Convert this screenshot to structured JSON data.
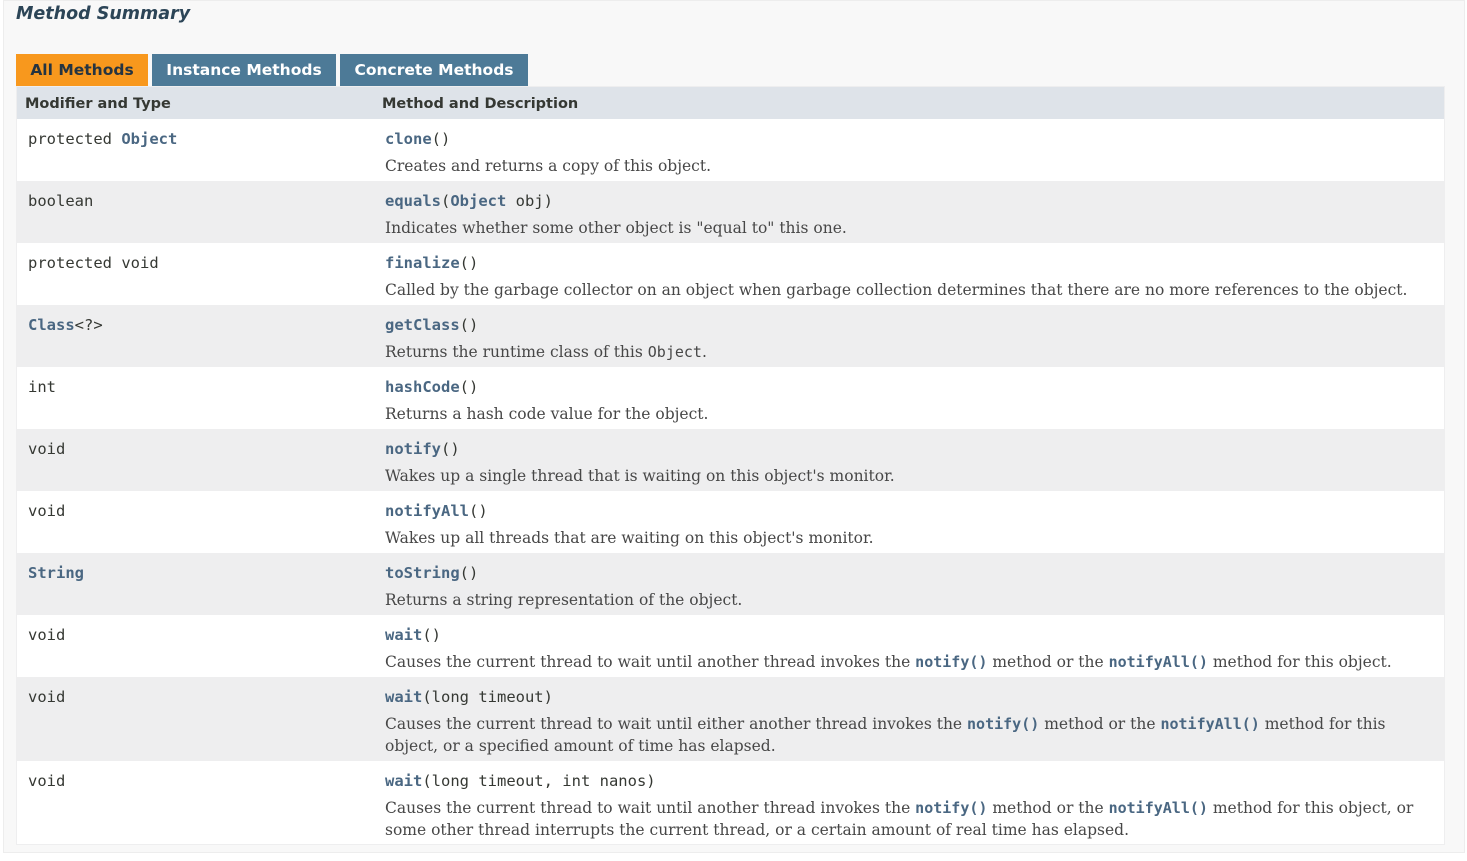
{
  "summary": {
    "title": "Method Summary"
  },
  "tabs": [
    {
      "label": "All Methods",
      "active": true
    },
    {
      "label": "Instance Methods",
      "active": false
    },
    {
      "label": "Concrete Methods",
      "active": false
    }
  ],
  "table": {
    "headers": [
      "Modifier and Type",
      "Method and Description"
    ],
    "rows": [
      {
        "mod_prefix": "protected ",
        "mod_link": "Object",
        "mod_suffix": "",
        "method": "clone",
        "params_before": "()",
        "param_link": "",
        "params_after": "",
        "desc": [
          "Creates and returns a copy of this object."
        ]
      },
      {
        "mod_prefix": "boolean",
        "mod_link": "",
        "mod_suffix": "",
        "method": "equals",
        "params_before": "(",
        "param_link": "Object",
        "params_after": " obj)",
        "desc": [
          "Indicates whether some other object is \"equal to\" this one."
        ]
      },
      {
        "mod_prefix": "protected void",
        "mod_link": "",
        "mod_suffix": "",
        "method": "finalize",
        "params_before": "()",
        "param_link": "",
        "params_after": "",
        "desc": [
          "Called by the garbage collector on an object when garbage collection determines that there are no more references to the object."
        ]
      },
      {
        "mod_prefix": "",
        "mod_link": "Class",
        "mod_suffix": "<?>",
        "method": "getClass",
        "params_before": "()",
        "param_link": "",
        "params_after": "",
        "desc": [
          "Returns the runtime class of this ",
          "Object",
          "."
        ]
      },
      {
        "mod_prefix": "int",
        "mod_link": "",
        "mod_suffix": "",
        "method": "hashCode",
        "params_before": "()",
        "param_link": "",
        "params_after": "",
        "desc": [
          "Returns a hash code value for the object."
        ]
      },
      {
        "mod_prefix": "void",
        "mod_link": "",
        "mod_suffix": "",
        "method": "notify",
        "params_before": "()",
        "param_link": "",
        "params_after": "",
        "desc": [
          "Wakes up a single thread that is waiting on this object's monitor."
        ]
      },
      {
        "mod_prefix": "void",
        "mod_link": "",
        "mod_suffix": "",
        "method": "notifyAll",
        "params_before": "()",
        "param_link": "",
        "params_after": "",
        "desc": [
          "Wakes up all threads that are waiting on this object's monitor."
        ]
      },
      {
        "mod_prefix": "",
        "mod_link": "String",
        "mod_suffix": "",
        "method": "toString",
        "params_before": "()",
        "param_link": "",
        "params_after": "",
        "desc": [
          "Returns a string representation of the object."
        ]
      },
      {
        "mod_prefix": "void",
        "mod_link": "",
        "mod_suffix": "",
        "method": "wait",
        "params_before": "()",
        "param_link": "",
        "params_after": "",
        "desc": [
          "Causes the current thread to wait until another thread invokes the ",
          "notify()",
          " method or the ",
          "notifyAll()",
          " method for this object."
        ]
      },
      {
        "mod_prefix": "void",
        "mod_link": "",
        "mod_suffix": "",
        "method": "wait",
        "params_before": "(long timeout)",
        "param_link": "",
        "params_after": "",
        "desc": [
          "Causes the current thread to wait until either another thread invokes the ",
          "notify()",
          " method or the ",
          "notifyAll()",
          " method for this object, or a specified amount of time has elapsed."
        ]
      },
      {
        "mod_prefix": "void",
        "mod_link": "",
        "mod_suffix": "",
        "method": "wait",
        "params_before": "(long timeout, int nanos)",
        "param_link": "",
        "params_after": "",
        "desc": [
          "Causes the current thread to wait until another thread invokes the ",
          "notify()",
          " method or the ",
          "notifyAll()",
          " method for this object, or some other thread interrupts the current thread, or a certain amount of real time has elapsed."
        ]
      }
    ]
  }
}
